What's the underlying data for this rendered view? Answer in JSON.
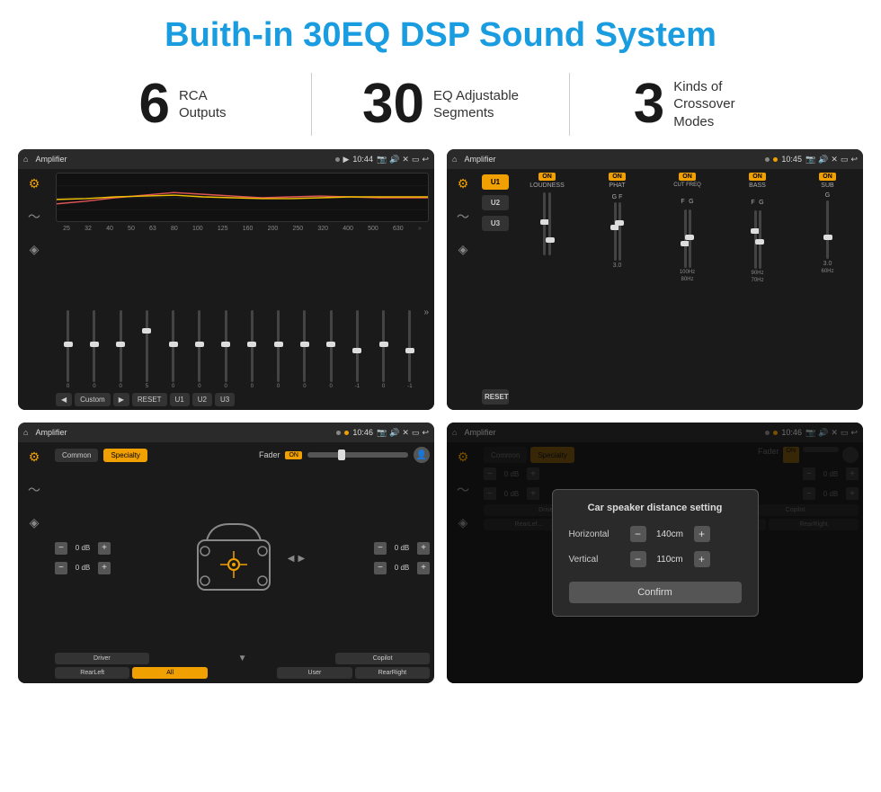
{
  "header": {
    "title": "Buith-in 30EQ DSP Sound System"
  },
  "stats": [
    {
      "number": "6",
      "text": "RCA\nOutputs"
    },
    {
      "number": "30",
      "text": "EQ Adjustable\nSegments"
    },
    {
      "number": "3",
      "text": "Kinds of\nCrossover Modes"
    }
  ],
  "screens": [
    {
      "id": "eq-screen",
      "title": "Amplifier",
      "time": "10:44",
      "type": "eq"
    },
    {
      "id": "amp-screen",
      "title": "Amplifier",
      "time": "10:45",
      "type": "amp"
    },
    {
      "id": "speaker-screen",
      "title": "Amplifier",
      "time": "10:46",
      "type": "speaker"
    },
    {
      "id": "dist-screen",
      "title": "Amplifier",
      "time": "10:46",
      "type": "dist"
    }
  ],
  "eq": {
    "frequencies": [
      "25",
      "32",
      "40",
      "50",
      "63",
      "80",
      "100",
      "125",
      "160",
      "200",
      "250",
      "320",
      "400",
      "500",
      "630"
    ],
    "values": [
      "0",
      "0",
      "0",
      "5",
      "0",
      "0",
      "0",
      "0",
      "0",
      "0",
      "0",
      "-1",
      "0",
      "-1"
    ],
    "preset": "Custom",
    "buttons": [
      "RESET",
      "U1",
      "U2",
      "U3"
    ]
  },
  "amp": {
    "presets": [
      "U1",
      "U2",
      "U3"
    ],
    "controls": [
      "LOUDNESS",
      "PHAT",
      "CUT FREQ",
      "BASS",
      "SUB"
    ],
    "reset": "RESET"
  },
  "speaker": {
    "tabs": [
      "Common",
      "Specialty"
    ],
    "fader": "Fader",
    "fader_on": "ON",
    "buttons": [
      "Driver",
      "RearLeft",
      "All",
      "User",
      "RearRight",
      "Copilot"
    ],
    "db_values": [
      "0 dB",
      "0 dB",
      "0 dB",
      "0 dB"
    ]
  },
  "dialog": {
    "title": "Car speaker distance setting",
    "horizontal_label": "Horizontal",
    "horizontal_value": "140cm",
    "vertical_label": "Vertical",
    "vertical_value": "110cm",
    "confirm": "Confirm"
  }
}
